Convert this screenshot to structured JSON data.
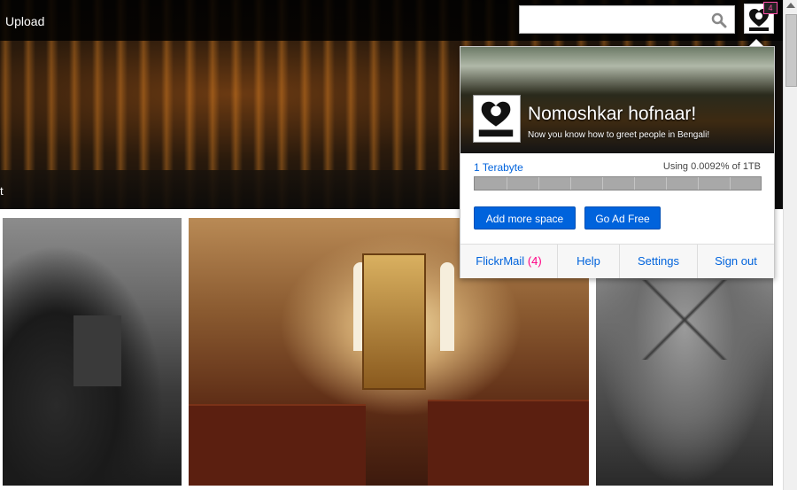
{
  "header": {
    "upload_label": "Upload",
    "search_placeholder": "",
    "notification_count": "4",
    "stray_text": "t"
  },
  "account_panel": {
    "greeting": "Nomoshkar hofnaar!",
    "greeting_sub": "Now you know how to greet people in Bengali!",
    "storage_label": "1 Terabyte",
    "storage_usage": "Using 0.0092% of 1TB",
    "storage_fraction": 9.2e-05,
    "buttons": {
      "add_space": "Add more space",
      "ad_free": "Go Ad Free"
    },
    "footer": {
      "mail_label": "FlickrMail",
      "mail_count": "(4)",
      "help": "Help",
      "settings": "Settings",
      "sign_out": "Sign out"
    }
  },
  "colors": {
    "link_blue": "#0063dc",
    "pink": "#ff0084"
  },
  "icons": {
    "search": "search-icon",
    "avatar": "hofnaar-logo"
  }
}
